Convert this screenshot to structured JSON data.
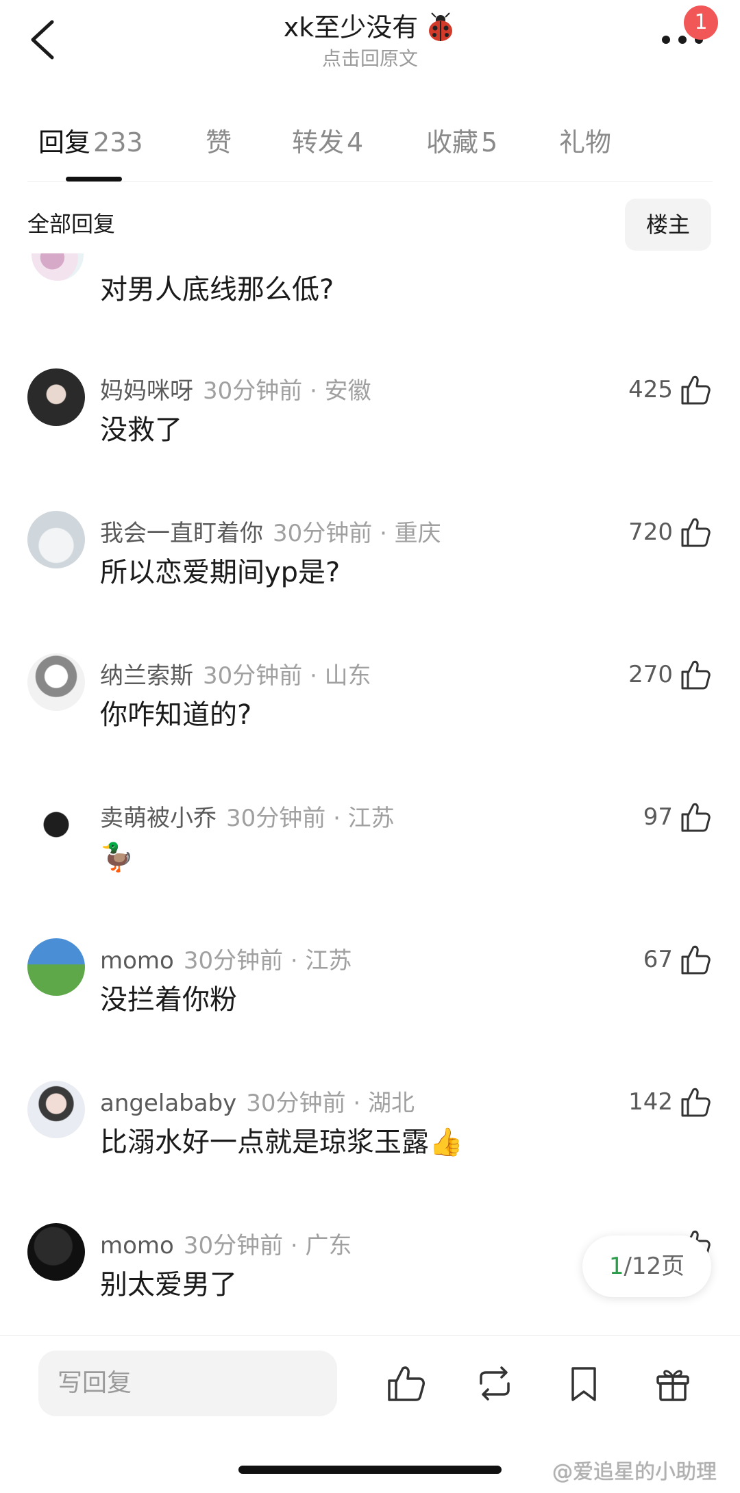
{
  "header": {
    "title": "xk至少没有",
    "subtitle": "点击回原文",
    "badge": "1"
  },
  "tabs": [
    {
      "label": "回复",
      "count": "233",
      "active": true
    },
    {
      "label": "赞",
      "count": "",
      "active": false
    },
    {
      "label": "转发",
      "count": "4",
      "active": false
    },
    {
      "label": "收藏",
      "count": "5",
      "active": false
    },
    {
      "label": "礼物",
      "count": "",
      "active": false
    }
  ],
  "filter": {
    "label": "全部回复",
    "owner_button": "楼主"
  },
  "partial_comment": {
    "text": "对男人底线那么低?"
  },
  "comments": [
    {
      "username": "妈妈咪呀",
      "time": "30分钟前 · 安徽",
      "text": "没救了",
      "likes": "425"
    },
    {
      "username": "我会一直盯着你",
      "time": "30分钟前 · 重庆",
      "text": "所以恋爱期间yp是?",
      "likes": "720"
    },
    {
      "username": "纳兰索斯",
      "time": "30分钟前 · 山东",
      "text": "你咋知道的?",
      "likes": "270"
    },
    {
      "username": "卖萌被小乔",
      "time": "30分钟前 · 江苏",
      "text": "🦆",
      "likes": "97"
    },
    {
      "username": "momo",
      "time": "30分钟前 · 江苏",
      "text": "没拦着你粉",
      "likes": "67"
    },
    {
      "username": "angelababy",
      "time": "30分钟前 · 湖北",
      "text": "比溺水好一点就是琼浆玉露👍",
      "likes": "142"
    },
    {
      "username": "momo",
      "time": "30分钟前 · 广东",
      "text": "别太爱男了",
      "likes": ""
    }
  ],
  "pagination": {
    "current": "1",
    "rest": "/12页"
  },
  "bottom_bar": {
    "reply_placeholder": "写回复"
  },
  "watermark": "@爱追星的小助理",
  "colors": {
    "badge": "#f25757",
    "page_current": "#2a9d4a"
  }
}
